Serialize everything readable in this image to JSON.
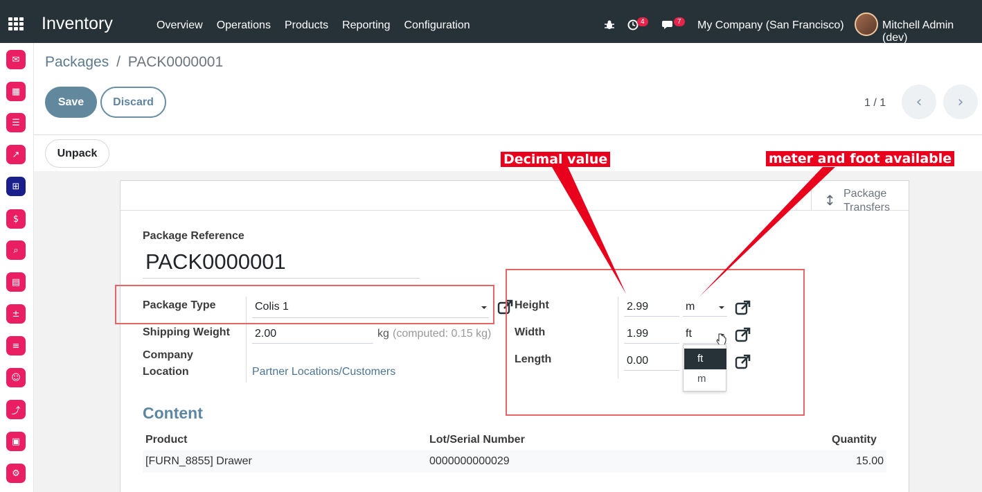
{
  "app": {
    "title": "Inventory"
  },
  "menu": [
    "Overview",
    "Operations",
    "Products",
    "Reporting",
    "Configuration"
  ],
  "systray": {
    "activities_count": "4",
    "messages_count": "7",
    "company": "My Company (San Francisco)",
    "user": "Mitchell Admin (dev)"
  },
  "breadcrumb": {
    "parent": "Packages",
    "separator": "/",
    "current": "PACK0000001"
  },
  "buttons": {
    "save": "Save",
    "discard": "Discard",
    "unpack": "Unpack"
  },
  "pager": {
    "value": "1 / 1"
  },
  "stat_button": {
    "label": "Package Transfers"
  },
  "form": {
    "reference_label": "Package Reference",
    "reference_value": "PACK0000001",
    "package_type_label": "Package Type",
    "package_type_value": "Colis 1",
    "shipping_weight_label": "Shipping Weight",
    "shipping_weight_value": "2.00",
    "weight_unit": "kg",
    "weight_computed": "(computed: 0.15 kg)",
    "company_label": "Company",
    "location_label": "Location",
    "location_value": "Partner Locations/Customers",
    "height_label": "Height",
    "height_value": "2.99",
    "height_unit": "m",
    "width_label": "Width",
    "width_value": "1.99",
    "width_unit": "ft",
    "length_label": "Length",
    "length_value": "0.00"
  },
  "unit_dropdown": {
    "options": [
      "ft",
      "m"
    ],
    "selected": "ft"
  },
  "annotations": {
    "decimal_callout": "Decimal value",
    "units_callout": "meter and foot available"
  },
  "content": {
    "title": "Content",
    "columns": [
      "Product",
      "Lot/Serial Number",
      "Quantity"
    ],
    "rows": [
      {
        "product": "[FURN_8855] Drawer",
        "lot": "0000000000029",
        "quantity": "15.00"
      }
    ]
  },
  "colors": {
    "topbar": "#263238",
    "primary": "#62889e",
    "app_icon": "#e91e63",
    "annotation_red": "#e8001c"
  }
}
